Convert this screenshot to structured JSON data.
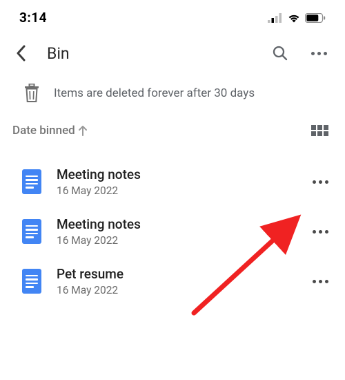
{
  "status": {
    "time": "3:14"
  },
  "header": {
    "title": "Bin"
  },
  "banner": {
    "text": "Items are deleted forever after 30 days"
  },
  "sort": {
    "label": "Date binned"
  },
  "files": [
    {
      "name": "Meeting notes",
      "date": "16 May 2022"
    },
    {
      "name": "Meeting notes",
      "date": "16 May 2022"
    },
    {
      "name": "Pet resume",
      "date": "16 May 2022"
    }
  ]
}
